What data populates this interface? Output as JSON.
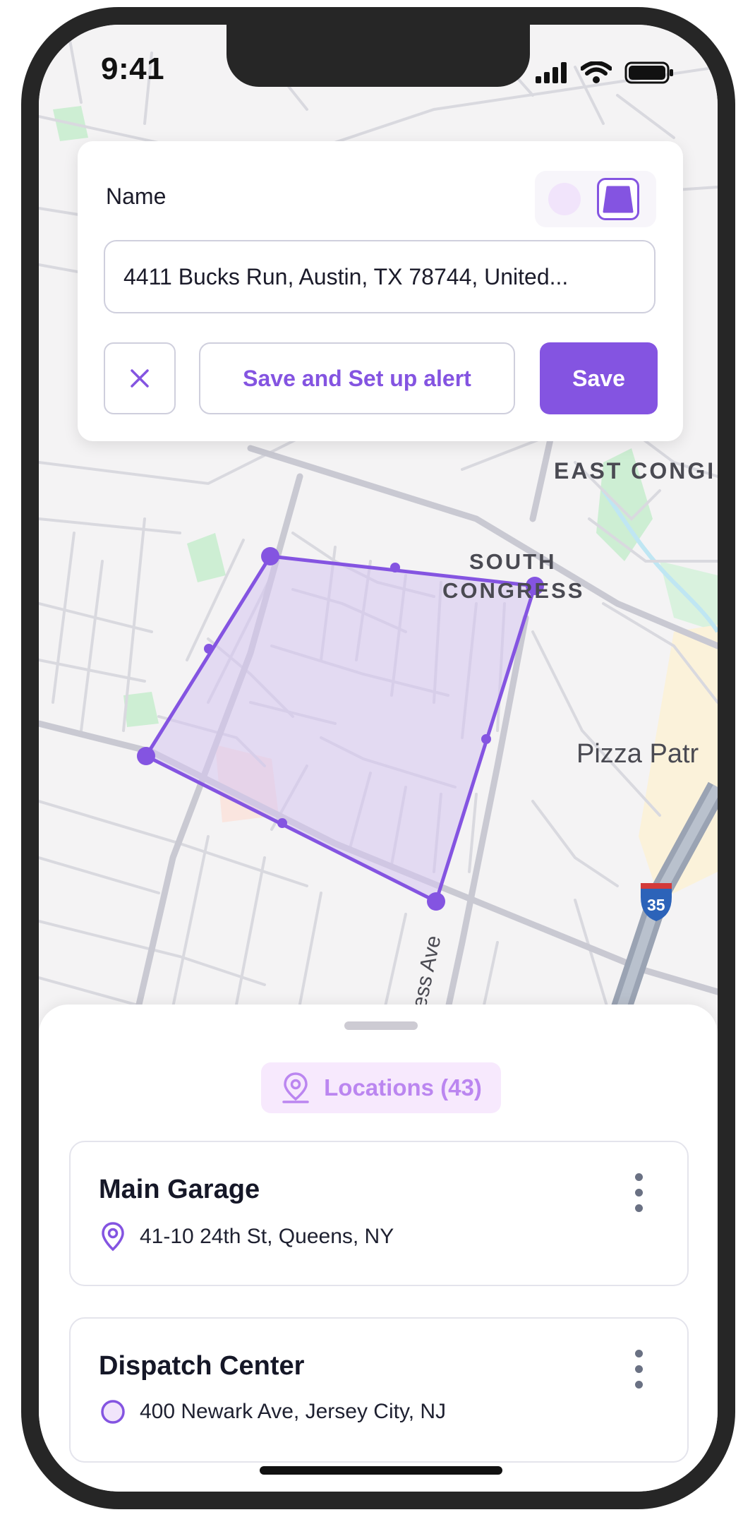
{
  "status_bar": {
    "time": "9:41"
  },
  "editor": {
    "name_label": "Name",
    "name_value": "4411 Bucks Run, Austin, TX 78744, United...",
    "shape_options": [
      "circle-shape-icon",
      "polygon-shape-icon"
    ],
    "selected_shape": "polygon",
    "save_alert_label": "Save and Set up alert",
    "save_label": "Save",
    "close_icon": "close-icon"
  },
  "map": {
    "labels": {
      "east_congress": "EAST CONGI",
      "south_congress_1": "SOUTH",
      "south_congress_2": "CONGRESS",
      "pizza": "Pizza Patr",
      "street": "ess Ave",
      "interstate": "35"
    }
  },
  "sheet": {
    "chip_label": "Locations (43)",
    "locations": [
      {
        "name": "Main Garage",
        "address": "41-10 24th St, Queens, NY",
        "icon": "map-pin-icon"
      },
      {
        "name": "Dispatch Center",
        "address": "400 Newark Ave, Jersey City, NJ",
        "icon": "circle-geofence-icon"
      }
    ]
  },
  "colors": {
    "accent": "#8454e1",
    "accent_light": "#f7e9fd",
    "polygon_fill": "#e8dcf4",
    "map_bg": "#f4f3f4",
    "road": "#d8d8de",
    "park": "#cdeed3"
  }
}
